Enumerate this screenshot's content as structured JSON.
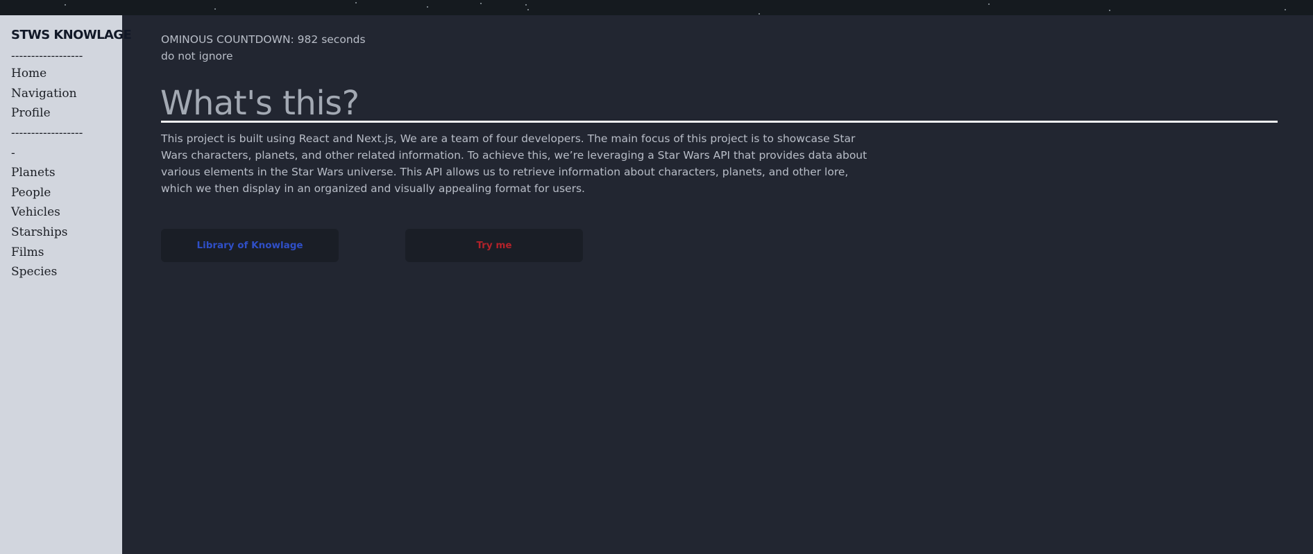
{
  "sidebar": {
    "brand": "STWS KNOWLAGE",
    "separator_top": "------------------",
    "links_top": [
      "Home",
      "Navigation",
      "Profile"
    ],
    "separator_mid": "------------------",
    "dash": "-",
    "links_bottom": [
      "Planets",
      "People",
      "Vehicles",
      "Starships",
      "Films",
      "Species"
    ]
  },
  "main": {
    "countdown": "OMINOUS COUNTDOWN: 982 seconds",
    "warning": "do not ignore",
    "heading": "What's this?",
    "description": "This project is built using React and Next.js, We are a team of four developers. The main focus of this project is to showcase Star Wars characters, planets, and other related information. To achieve this, we’re leveraging a Star Wars API that provides data about various elements in the Star Wars universe. This API allows us to retrieve information about characters, planets, and other lore, which we then display in an organized and visually appealing format for users.",
    "buttons": {
      "library": "Library of Knowlage",
      "try": "Try me"
    }
  },
  "colors": {
    "page_background": "#222631",
    "sidebar_background": "#d2d6de",
    "library_button_text": "#2f4fc7",
    "try_button_text": "#b3222a"
  }
}
